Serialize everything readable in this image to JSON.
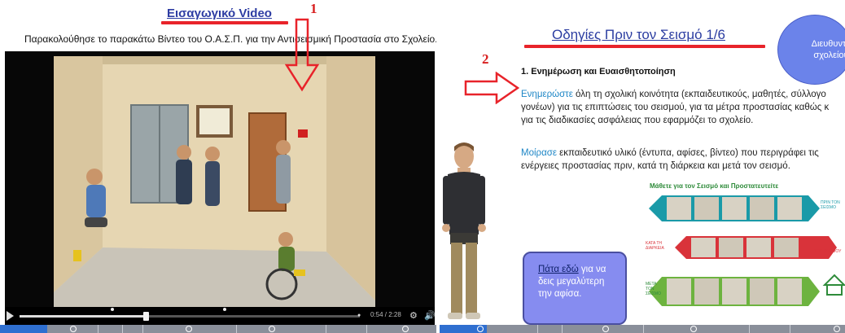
{
  "left": {
    "title": "Εισαγωγικό Video",
    "marker": "1",
    "instruction": "Παρακολούθησε το παρακάτω Βίντεο του Ο.Α.Σ.Π. για την Αντισεισμική Προστασία στο Σχολείο.",
    "player": {
      "time": "0:54 / 2:28",
      "progress_fraction": 0.37,
      "settings_icon": "gear-icon",
      "volume_icon": "speaker-icon"
    }
  },
  "right": {
    "title": "Οδηγίες Πριν τον Σεισμό 1/6",
    "marker": "2",
    "principal_line1": "Διευθυντή",
    "principal_line2": "σχολείου",
    "section_heading": "1. Ενημέρωση και Ευαισθητοποίηση",
    "p1": {
      "highlight": "Ενημερώστε",
      "line1_rest": " όλη τη σχολική κοινότητα (εκπαιδευτικούς, μαθητές, σύλλογο",
      "line2": "γονέων) για τις επιπτώσεις του σεισμού, για τα μέτρα προστασίας καθώς κ",
      "line3": "για τις διαδικασίες ασφάλειας που εφαρμόζει το σχολείο."
    },
    "p2": {
      "highlight": "Μοίρασε",
      "line1_rest": " εκπαιδευτικό υλικό (έντυπα, αφίσες, βίντεο) που περιγράφει τις",
      "line2": "ενέργειες προστασίας πριν, κατά τη διάρκεια και μετά τον σεισμό."
    },
    "info": {
      "link": "Πάτα εδώ",
      "line1_rest": " για να",
      "line2": "δεις μεγαλύτερη",
      "line3": "την αφίσα."
    },
    "poster": {
      "title": "Μάθετε για τον Σεισμό και Προστατευτείτε",
      "row_labels": [
        "ΠΡΙΝ ΤΟΝ ΣΕΙΣΜΟ",
        "ΚΑΤΑ ΤΗ ΔΙΑΡΚΕΙΑ",
        "ΤΟΥ ΣΕΙΣΜΟΥ",
        "ΜΕΤΑ ΤΟΝ ΣΕΙΣΜΟ"
      ]
    }
  },
  "colors": {
    "title_blue": "#2e3da3",
    "red_accent": "#e8232a",
    "highlight_blue": "#1e86c6",
    "info_box": "#868cf0",
    "principal_circle": "#6b83ea",
    "poster_teal": "#1a9aa8",
    "poster_red": "#d9333a",
    "poster_green": "#6db33f"
  }
}
